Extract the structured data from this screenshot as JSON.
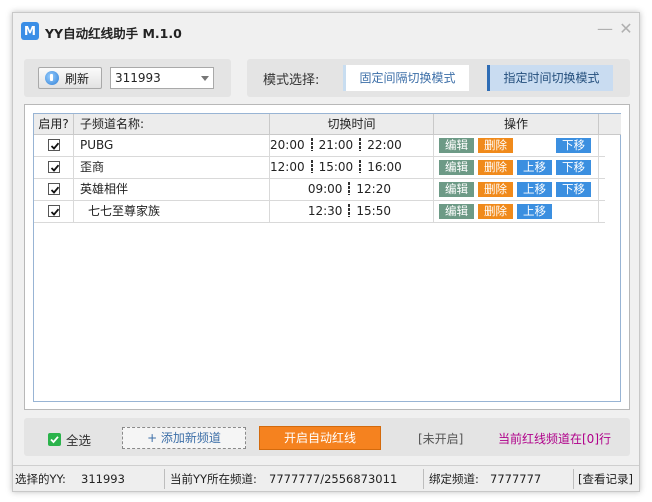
{
  "window": {
    "title": "YY自动红线助手 M.1.0",
    "icon_letter": "M",
    "minimize_glyph": "—",
    "close_glyph": "✕"
  },
  "toolbar": {
    "refresh_label": "刷新",
    "yy_id": "311993"
  },
  "mode": {
    "label": "模式选择:",
    "options": [
      "固定间隔切换模式",
      "指定时间切换模式"
    ],
    "selected": "指定时间切换模式"
  },
  "table": {
    "headers": {
      "enabled": "启用?",
      "channel": "子频道名称:",
      "times": "切换时间",
      "actions": "操作"
    },
    "rows": [
      {
        "enabled": true,
        "channel": "PUBG",
        "time_text": "20:00",
        "time_text2": "21:00",
        "time_text3": "22:00",
        "ops": [
          "编辑",
          "删除",
          "下移"
        ]
      },
      {
        "enabled": true,
        "channel": "歪商",
        "time_text": "12:00",
        "time_text2": "15:00",
        "time_text3": "16:00",
        "ops": [
          "编辑",
          "删除",
          "上移",
          "下移"
        ]
      },
      {
        "enabled": true,
        "channel": "英雄相伴",
        "time_text": "09:00",
        "time_text2": "12:20",
        "time_text3": "",
        "ops": [
          "编辑",
          "删除",
          "上移",
          "下移"
        ]
      },
      {
        "enabled": true,
        "channel": "七七至尊家族",
        "time_text": "12:30",
        "time_text2": "15:50",
        "time_text3": "",
        "ops": [
          "编辑",
          "删除",
          "上移"
        ]
      }
    ],
    "op_labels": {
      "edit": "编辑",
      "delete": "删除",
      "up": "上移",
      "down": "下移"
    }
  },
  "bottom": {
    "select_all": "全选",
    "add_channel": "+ 添加新频道",
    "start_button": "开启自动红线",
    "state": "[未开启]",
    "current_line": "当前红线频道在[0]行"
  },
  "status": {
    "selected_yy_label": "选择的YY:",
    "selected_yy_value": "311993",
    "current_channel_label": "当前YY所在频道:",
    "current_channel_value": "7777777/2556873011",
    "bound_channel_label": "绑定频道:",
    "bound_channel_value": "7777777",
    "log_link": "[查看记录]"
  },
  "colors": {
    "accent_blue": "#3b8fe0",
    "edit_green": "#6d9a86",
    "delete_orange": "#f08a1b",
    "start_orange": "#f5821f",
    "current_line_purple": "#b0008a"
  },
  "icons": [
    "refresh-icon",
    "minimize-icon",
    "close-icon",
    "checkmark-icon",
    "dropdown-arrow-icon"
  ]
}
